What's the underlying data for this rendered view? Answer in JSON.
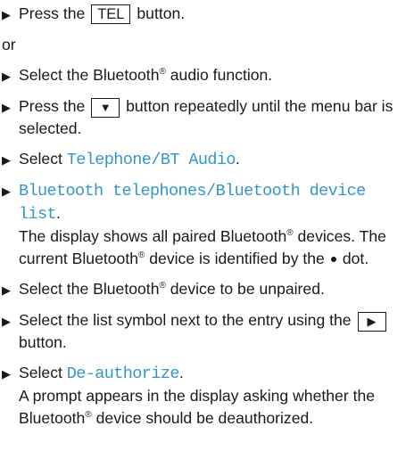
{
  "steps": {
    "s1": {
      "pre": "Press the",
      "key": "TEL",
      "post": "button."
    },
    "or": "or",
    "s2": {
      "pre": "Select the Bluetooth",
      "sup": "®",
      "post": "audio function."
    },
    "s3": {
      "pre": "Press the",
      "key_icon": "down-triangle-icon",
      "key_glyph": "▼",
      "post": "button repeatedly until the menu bar is selected."
    },
    "s4": {
      "pre": "Select",
      "kw1": "Telephone",
      "sep": "/",
      "kw2": "BT Audio",
      "post": "."
    },
    "s5": {
      "kw1": "Bluetooth telephones",
      "sep": "/",
      "kw2": "Bluetooth device list",
      "post": ".",
      "note_pre": "The display shows all paired Bluetooth",
      "note_sup": "®",
      "note_mid": "devices. The current Bluetooth",
      "note_sup2": "®",
      "note_mid2": "device is identified by the",
      "note_post": "dot."
    },
    "s6": {
      "pre": "Select the Bluetooth",
      "sup": "®",
      "post": "device to be unpaired."
    },
    "s7": {
      "pre": "Select the list symbol next to the entry using the",
      "key_icon": "right-triangle-icon",
      "key_glyph": "▶",
      "post": "button."
    },
    "s8": {
      "pre": "Select",
      "kw": "De-authorize",
      "post": ".",
      "note_pre": "A prompt appears in the display asking whether the Bluetooth",
      "note_sup": "®",
      "note_post": "device should be deauthorized."
    }
  },
  "colors": {
    "keyword": "#3396c8",
    "text": "#1a1a1a"
  }
}
